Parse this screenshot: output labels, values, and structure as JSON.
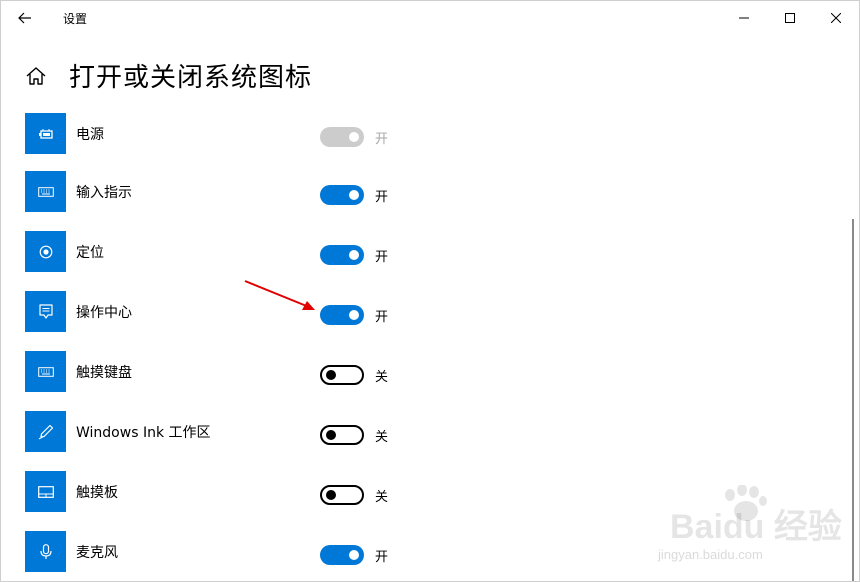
{
  "window": {
    "title": "设置"
  },
  "page": {
    "title": "打开或关闭系统图标"
  },
  "items": [
    {
      "label": "电源",
      "state": "开",
      "on": true,
      "disabled": true,
      "icon": "battery-icon"
    },
    {
      "label": "输入指示",
      "state": "开",
      "on": true,
      "disabled": false,
      "icon": "keyboard-icon"
    },
    {
      "label": "定位",
      "state": "开",
      "on": true,
      "disabled": false,
      "icon": "location-icon"
    },
    {
      "label": "操作中心",
      "state": "开",
      "on": true,
      "disabled": false,
      "icon": "action-center-icon"
    },
    {
      "label": "触摸键盘",
      "state": "关",
      "on": false,
      "disabled": false,
      "icon": "touch-keyboard-icon"
    },
    {
      "label": "Windows Ink 工作区",
      "state": "关",
      "on": false,
      "disabled": false,
      "icon": "pen-icon"
    },
    {
      "label": "触摸板",
      "state": "关",
      "on": false,
      "disabled": false,
      "icon": "touchpad-icon"
    },
    {
      "label": "麦克风",
      "state": "开",
      "on": true,
      "disabled": false,
      "icon": "microphone-icon"
    }
  ],
  "watermark": {
    "text": "Baidu 经验",
    "sub": "jingyan.baidu.com"
  },
  "colors": {
    "accent": "#0078d7",
    "annotation_arrow": "#e00000"
  }
}
